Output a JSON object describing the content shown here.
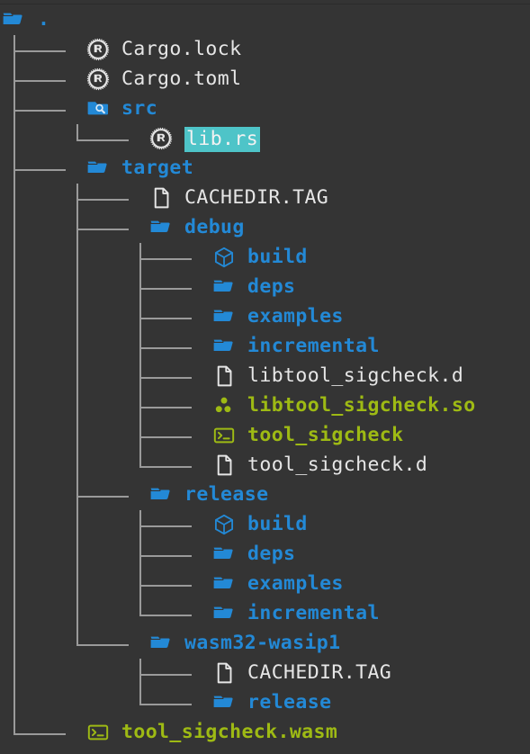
{
  "window": {
    "kind": "terminal-file-tree",
    "background_color": "#343434"
  },
  "colors": {
    "background": "#343434",
    "guide_line": "#9a9a9a",
    "plain_file": "#e6e6e6",
    "directory": "#2389d6",
    "executable": "#9eba14",
    "selection_background": "#4ec4c8",
    "selection_text": "#f2f2f2"
  },
  "tree": {
    "root": {
      "label": ".",
      "icon": "folder-open-icon",
      "style": "dir"
    },
    "rows": [
      {
        "label": "Cargo.lock",
        "icon": "rust-icon",
        "style": "plain",
        "depth": 1,
        "last": false,
        "selected": false
      },
      {
        "label": "Cargo.toml",
        "icon": "rust-icon",
        "style": "plain",
        "depth": 1,
        "last": false,
        "selected": false
      },
      {
        "label": "src",
        "icon": "folder-source-icon",
        "style": "dir",
        "depth": 1,
        "last": false,
        "selected": false
      },
      {
        "label": "lib.rs",
        "icon": "rust-icon",
        "style": "plain",
        "depth": 2,
        "last": true,
        "selected": true
      },
      {
        "label": "target",
        "icon": "folder-open-icon",
        "style": "dir",
        "depth": 1,
        "last": false,
        "selected": false
      },
      {
        "label": "CACHEDIR.TAG",
        "icon": "file-icon",
        "style": "plain",
        "depth": 2,
        "last": false,
        "selected": false
      },
      {
        "label": "debug",
        "icon": "folder-open-icon",
        "style": "dir",
        "depth": 2,
        "last": false,
        "selected": false
      },
      {
        "label": "build",
        "icon": "package-cube-icon",
        "style": "dir",
        "depth": 3,
        "last": false,
        "selected": false
      },
      {
        "label": "deps",
        "icon": "folder-open-icon",
        "style": "dir",
        "depth": 3,
        "last": false,
        "selected": false
      },
      {
        "label": "examples",
        "icon": "folder-open-icon",
        "style": "dir",
        "depth": 3,
        "last": false,
        "selected": false
      },
      {
        "label": "incremental",
        "icon": "folder-open-icon",
        "style": "dir",
        "depth": 3,
        "last": false,
        "selected": false
      },
      {
        "label": "libtool_sigcheck.d",
        "icon": "file-icon",
        "style": "plain",
        "depth": 3,
        "last": false,
        "selected": false
      },
      {
        "label": "libtool_sigcheck.so",
        "icon": "shared-library-icon",
        "style": "exec",
        "depth": 3,
        "last": false,
        "selected": false
      },
      {
        "label": "tool_sigcheck",
        "icon": "terminal-icon",
        "style": "exec",
        "depth": 3,
        "last": false,
        "selected": false
      },
      {
        "label": "tool_sigcheck.d",
        "icon": "file-icon",
        "style": "plain",
        "depth": 3,
        "last": true,
        "selected": false
      },
      {
        "label": "release",
        "icon": "folder-open-icon",
        "style": "dir",
        "depth": 2,
        "last": false,
        "selected": false
      },
      {
        "label": "build",
        "icon": "package-cube-icon",
        "style": "dir",
        "depth": 3,
        "last": false,
        "selected": false
      },
      {
        "label": "deps",
        "icon": "folder-open-icon",
        "style": "dir",
        "depth": 3,
        "last": false,
        "selected": false
      },
      {
        "label": "examples",
        "icon": "folder-open-icon",
        "style": "dir",
        "depth": 3,
        "last": false,
        "selected": false
      },
      {
        "label": "incremental",
        "icon": "folder-open-icon",
        "style": "dir",
        "depth": 3,
        "last": true,
        "selected": false
      },
      {
        "label": "wasm32-wasip1",
        "icon": "folder-open-icon",
        "style": "dir",
        "depth": 2,
        "last": true,
        "selected": false
      },
      {
        "label": "CACHEDIR.TAG",
        "icon": "file-icon",
        "style": "plain",
        "depth": 3,
        "last": false,
        "selected": false
      },
      {
        "label": "release",
        "icon": "folder-open-icon",
        "style": "dir",
        "depth": 3,
        "last": true,
        "selected": false
      },
      {
        "label": "tool_sigcheck.wasm",
        "icon": "terminal-icon",
        "style": "exec",
        "depth": 1,
        "last": true,
        "selected": false
      }
    ]
  }
}
